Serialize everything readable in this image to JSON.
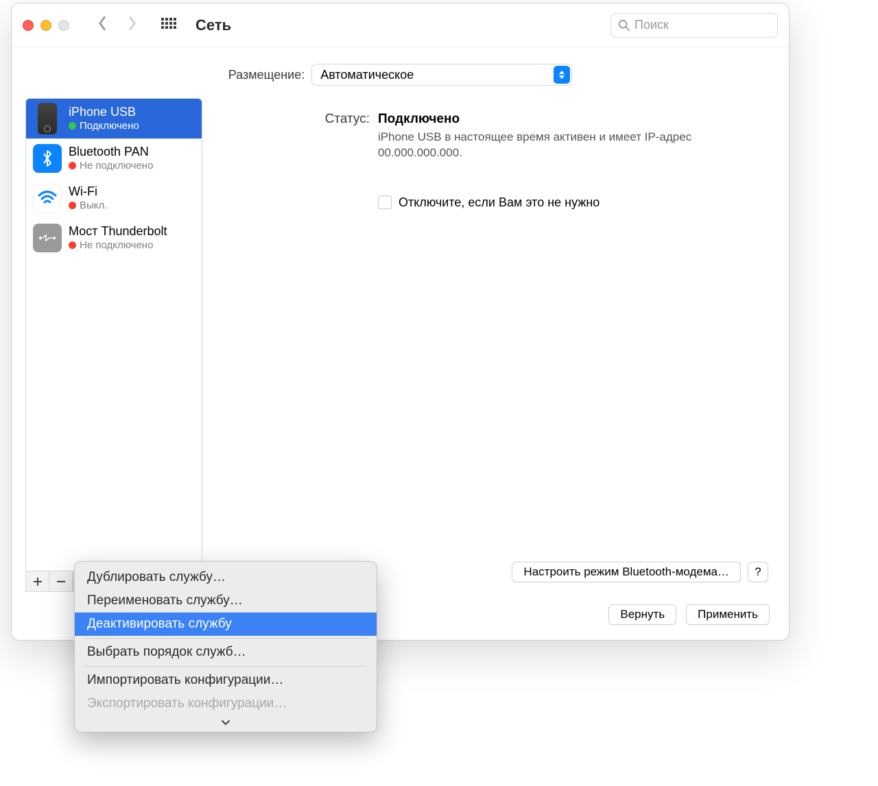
{
  "header": {
    "title": "Сеть",
    "search_placeholder": "Поиск"
  },
  "location": {
    "label": "Размещение:",
    "value": "Автоматическое"
  },
  "services": [
    {
      "name": "iPhone USB",
      "status": "Подключено",
      "dot": "green",
      "icon": "iphone",
      "selected": true
    },
    {
      "name": "Bluetooth PAN",
      "status": "Не подключено",
      "dot": "red",
      "icon": "bluetooth",
      "selected": false
    },
    {
      "name": "Wi-Fi",
      "status": "Выкл.",
      "dot": "red",
      "icon": "wifi",
      "selected": false
    },
    {
      "name": "Мост Thunderbolt",
      "status": "Не подключено",
      "dot": "red",
      "icon": "thunderbolt",
      "selected": false
    }
  ],
  "detail": {
    "status_label": "Статус:",
    "status_value": "Подключено",
    "status_desc": "iPhone USB в настоящее время активен и имеет IP-адрес 00.000.000.000.",
    "checkbox_label": "Отключите, если Вам это не нужно",
    "configure_button": "Настроить режим Bluetooth-модема…",
    "help": "?"
  },
  "footer": {
    "revert": "Вернуть",
    "apply": "Применить"
  },
  "menu": {
    "items": [
      "Дублировать службу…",
      "Переименовать службу…",
      "Деактивировать службу",
      "Выбрать порядок служб…",
      "Импортировать конфигурации…",
      "Экспортировать конфигурации…"
    ]
  }
}
